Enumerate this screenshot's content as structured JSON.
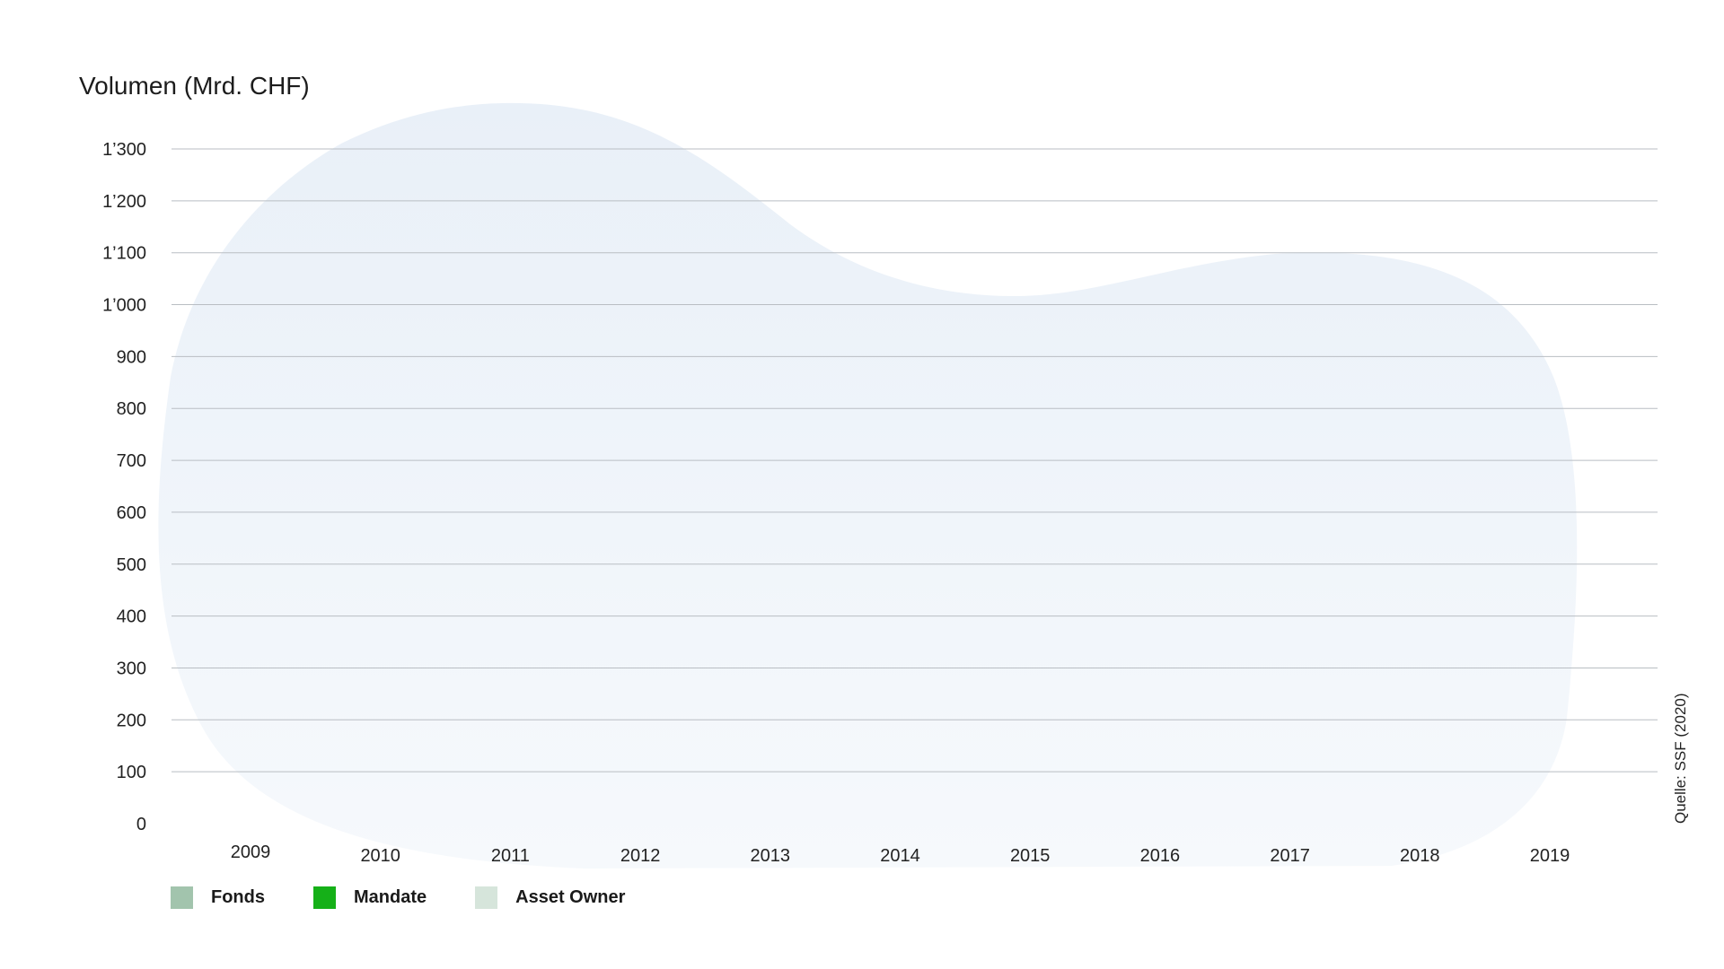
{
  "chart_data": {
    "type": "bar",
    "title": "Volumen (Mrd. CHF)",
    "categories": [
      "2009",
      "2010",
      "2011",
      "2012",
      "2013",
      "2014",
      "2015",
      "2016",
      "2017",
      "2018",
      "2019"
    ],
    "series": [
      {
        "name": "Fonds",
        "color": "#a2c4ad",
        "values": []
      },
      {
        "name": "Mandate",
        "color": "#15b018",
        "values": []
      },
      {
        "name": "Asset Owner",
        "color": "#d6e5db",
        "values": []
      }
    ],
    "ylim": [
      0,
      1300
    ],
    "yticks": [
      "0",
      "100",
      "200",
      "300",
      "400",
      "500",
      "600",
      "700",
      "800",
      "900",
      "1’000",
      "1’100",
      "1’200",
      "1’300"
    ],
    "grid": true,
    "legend": "bottom-left",
    "source": "Quelle: SSF (2020)"
  }
}
